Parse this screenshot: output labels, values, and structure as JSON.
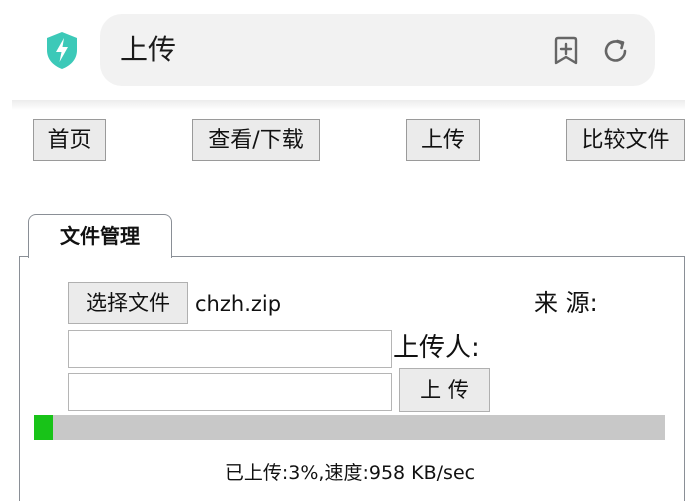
{
  "browser": {
    "title": "上传",
    "accent_color": "#3cc9b8",
    "icons": [
      "shield-bolt-icon",
      "add-bookmark-icon",
      "reload-icon"
    ]
  },
  "nav": {
    "home": "首页",
    "view_download": "查看/下载",
    "upload": "上传",
    "compare": "比较文件"
  },
  "tab": {
    "label": "文件管理"
  },
  "form": {
    "choose_file_label": "选择文件",
    "selected_file": "chzh.zip",
    "source_label": "来 源:",
    "uploader_label": "上传人:",
    "field1_value": "",
    "field2_value": "",
    "upload_button_label": "上 传"
  },
  "progress": {
    "percent": 3,
    "fill_color": "#18c318",
    "status_text": "已上传:3%,速度:958 KB/sec"
  }
}
